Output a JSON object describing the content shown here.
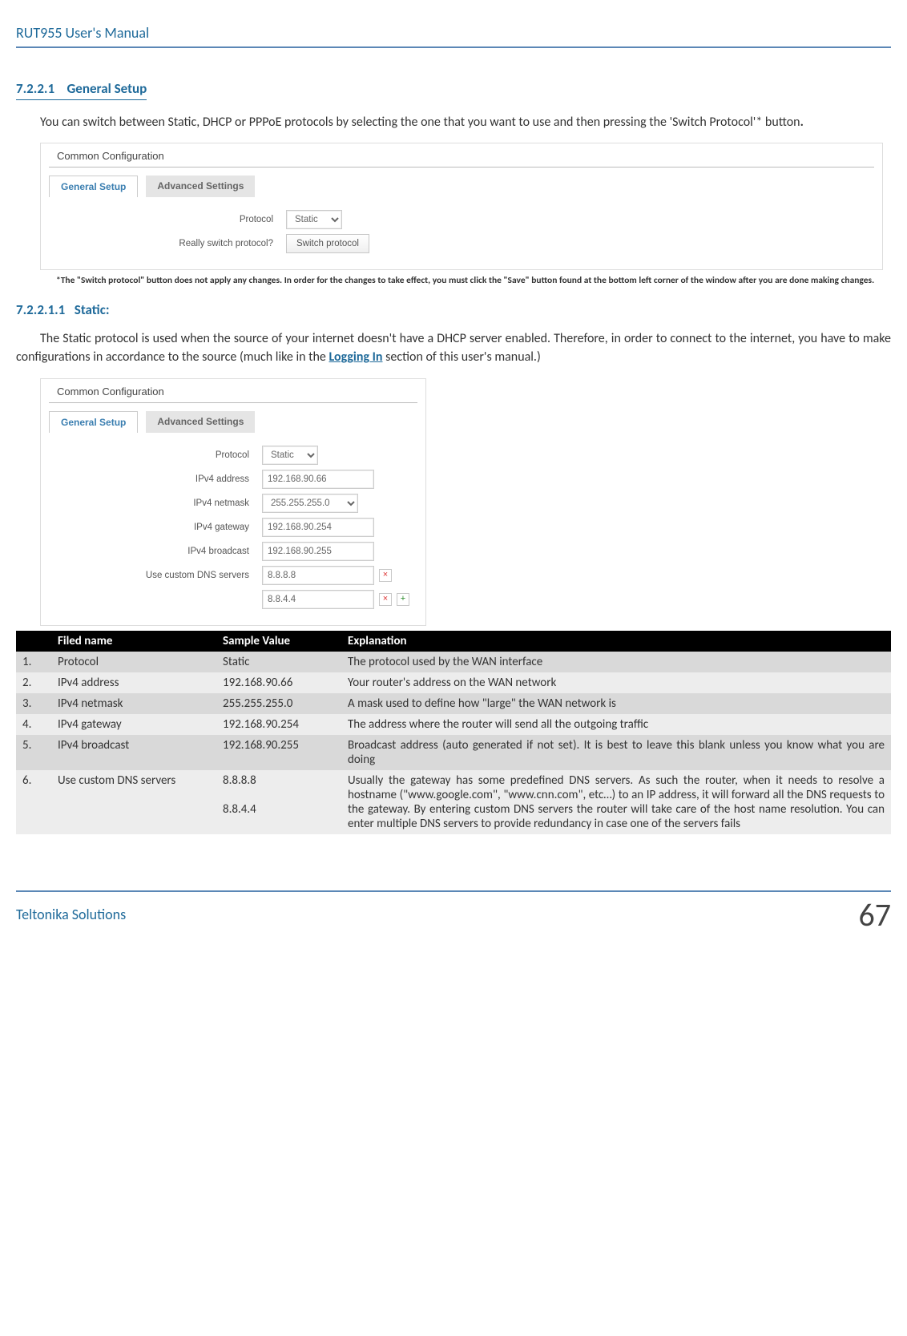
{
  "doc": {
    "header": "RUT955 User's Manual",
    "footer_left": "Teltonika Solutions",
    "page_number": "67"
  },
  "section721": {
    "number": "7.2.2.1",
    "title": "General Setup",
    "paragraph_a": "You can switch between Static, DHCP or PPPoE protocols by selecting the one that you want to use and then pressing the 'Switch Protocol'* button",
    "paragraph_b": ".",
    "footnote": "*The \"Switch protocol\" button does not apply any changes. In order for the changes to take effect, you must click the \"Save\" button found at the bottom left corner of the window after you are done making changes."
  },
  "screenshot1": {
    "title": "Common Configuration",
    "tab_active": "General Setup",
    "tab_inactive": "Advanced Settings",
    "rows": {
      "protocol_label": "Protocol",
      "protocol_value": "Static",
      "really_label": "Really switch protocol?",
      "switch_button": "Switch protocol"
    }
  },
  "section7211": {
    "number": "7.2.2.1.1",
    "title": "Static:",
    "paragraph_a": "The Static protocol is used when the source of your internet doesn't have a DHCP server enabled. Therefore, in order to connect to the internet, you have to make configurations in accordance to the source (much like in the ",
    "link_text": "Logging In",
    "paragraph_b": " section of this user's manual.)"
  },
  "screenshot2": {
    "title": "Common Configuration",
    "tab_active": "General Setup",
    "tab_inactive": "Advanced Settings",
    "rows": {
      "protocol_label": "Protocol",
      "protocol_value": "Static",
      "addr_label": "IPv4 address",
      "addr_value": "192.168.90.66",
      "mask_label": "IPv4 netmask",
      "mask_value": "255.255.255.0",
      "gw_label": "IPv4 gateway",
      "gw_value": "192.168.90.254",
      "bc_label": "IPv4 broadcast",
      "bc_value": "192.168.90.255",
      "dns_label": "Use custom DNS servers",
      "dns1": "8.8.8.8",
      "dns2": "8.8.4.4"
    }
  },
  "table": {
    "head": {
      "c1": "",
      "c2": "Filed name",
      "c3": "Sample Value",
      "c4": "Explanation"
    },
    "rows": [
      {
        "n": "1.",
        "name": "Protocol",
        "sample": "Static",
        "exp": "The protocol used by the WAN interface"
      },
      {
        "n": "2.",
        "name": "IPv4 address",
        "sample": "192.168.90.66",
        "exp": "Your router's address on the WAN network"
      },
      {
        "n": "3.",
        "name": "IPv4 netmask",
        "sample": "255.255.255.0",
        "exp": "A mask used to define how \"large\" the WAN network is"
      },
      {
        "n": "4.",
        "name": "IPv4 gateway",
        "sample": "192.168.90.254",
        "exp": "The address where the router will send all the outgoing traffic"
      },
      {
        "n": "5.",
        "name": "IPv4 broadcast",
        "sample": "192.168.90.255",
        "exp": "Broadcast address (auto generated if not set). It is best to leave this blank unless you know what you are doing"
      },
      {
        "n": "6.",
        "name": "Use custom DNS servers",
        "sample": "8.8.8.8\n\n8.8.4.4",
        "exp": "Usually the gateway has some predefined DNS servers. As such the router, when it needs to resolve a hostname (\"www.google.com\", \"www.cnn.com\", etc…) to an IP address, it will forward all the DNS requests to the gateway. By entering custom DNS servers the router will take care of the host name resolution. You can enter multiple DNS servers to provide redundancy in case one of the servers fails"
      }
    ]
  }
}
